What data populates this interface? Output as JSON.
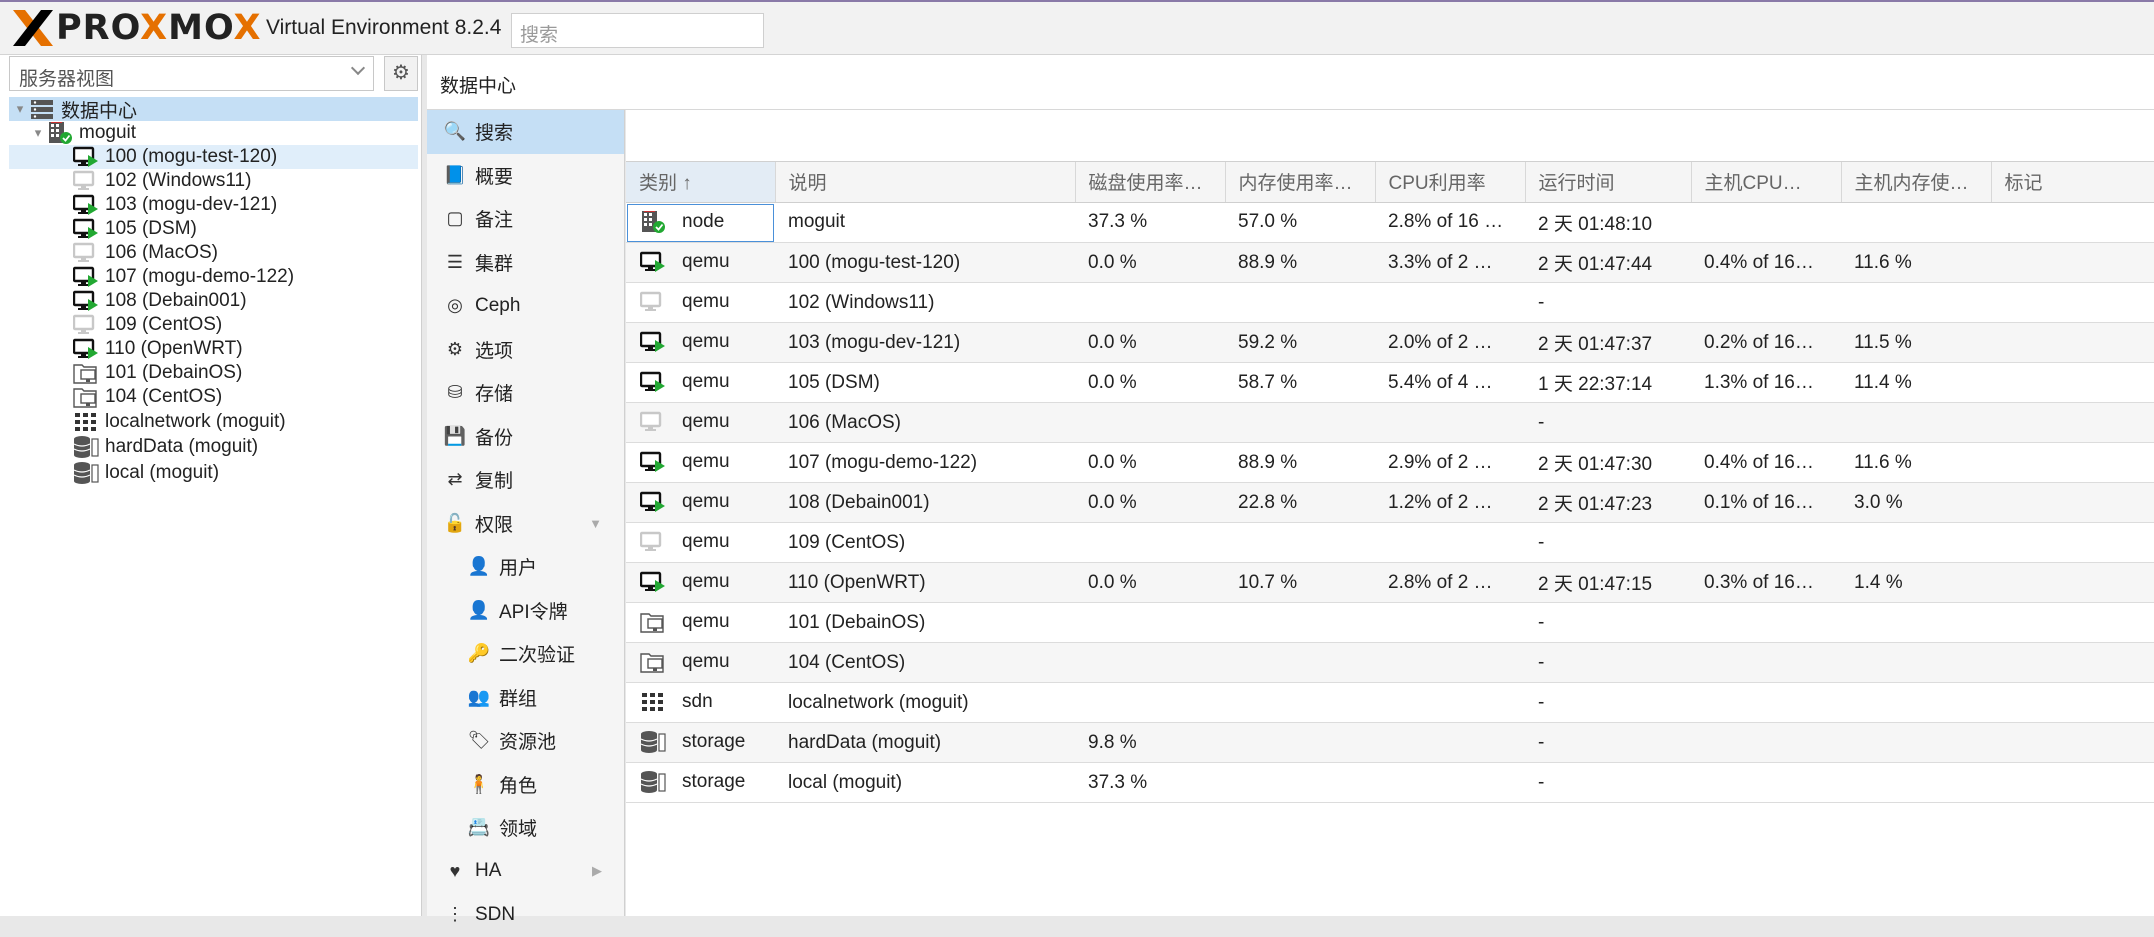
{
  "app": {
    "logo": "PROXMOX",
    "logo_x": "X",
    "logo_p": "PRO",
    "logo_o": "X",
    "logo_m": "MO",
    "logo_end": "X",
    "version": "Virtual Environment 8.2.4",
    "search_placeholder": "搜索"
  },
  "colors": {
    "accent": "#e57000",
    "selection": "#c5dff5",
    "running": "#22a832"
  },
  "left": {
    "view_select": "服务器视图",
    "tree": [
      {
        "label": "数据中心",
        "icon": "datacenter-icon",
        "level": 0,
        "toggle": "▾",
        "state": "selected"
      },
      {
        "label": "moguit",
        "icon": "node-icon",
        "level": 1,
        "toggle": "▾",
        "state": ""
      },
      {
        "label": "100 (mogu-test-120)",
        "icon": "vm-running-icon",
        "level": 2,
        "state": "hover"
      },
      {
        "label": "102 (Windows11)",
        "icon": "vm-stopped-icon",
        "level": 2,
        "state": ""
      },
      {
        "label": "103 (mogu-dev-121)",
        "icon": "vm-running-icon",
        "level": 2,
        "state": ""
      },
      {
        "label": "105 (DSM)",
        "icon": "vm-running-icon",
        "level": 2,
        "state": ""
      },
      {
        "label": "106 (MacOS)",
        "icon": "vm-stopped-icon",
        "level": 2,
        "state": ""
      },
      {
        "label": "107 (mogu-demo-122)",
        "icon": "vm-running-icon",
        "level": 2,
        "state": ""
      },
      {
        "label": "108 (Debain001)",
        "icon": "vm-running-icon",
        "level": 2,
        "state": ""
      },
      {
        "label": "109 (CentOS)",
        "icon": "vm-stopped-icon",
        "level": 2,
        "state": ""
      },
      {
        "label": "110 (OpenWRT)",
        "icon": "vm-running-icon",
        "level": 2,
        "state": ""
      },
      {
        "label": "101 (DebainOS)",
        "icon": "template-icon",
        "level": 2,
        "state": ""
      },
      {
        "label": "104 (CentOS)",
        "icon": "template-icon",
        "level": 2,
        "state": ""
      },
      {
        "label": "localnetwork (moguit)",
        "icon": "sdn-icon",
        "level": 2,
        "state": ""
      },
      {
        "label": "hardData (moguit)",
        "icon": "storage-icon",
        "level": 2,
        "state": ""
      },
      {
        "label": "local (moguit)",
        "icon": "storage-icon",
        "level": 2,
        "state": ""
      }
    ]
  },
  "breadcrumb": "数据中心",
  "menu": [
    {
      "label": "搜索",
      "icon": "search-icon",
      "glyph": "🔍",
      "sub": false,
      "selected": true
    },
    {
      "label": "概要",
      "icon": "book-icon",
      "glyph": "📘",
      "sub": false
    },
    {
      "label": "备注",
      "icon": "note-icon",
      "glyph": "▢",
      "sub": false
    },
    {
      "label": "集群",
      "icon": "server-icon",
      "glyph": "☰",
      "sub": false
    },
    {
      "label": "Ceph",
      "icon": "ceph-icon",
      "glyph": "◎",
      "sub": false
    },
    {
      "label": "选项",
      "icon": "gear-icon",
      "glyph": "⚙",
      "sub": false
    },
    {
      "label": "存储",
      "icon": "database-icon",
      "glyph": "⛁",
      "sub": false
    },
    {
      "label": "备份",
      "icon": "floppy-icon",
      "glyph": "💾",
      "sub": false
    },
    {
      "label": "复制",
      "icon": "retweet-icon",
      "glyph": "⇄",
      "sub": false
    },
    {
      "label": "权限",
      "icon": "unlock-icon",
      "glyph": "🔓",
      "sub": false,
      "arrow": "▼"
    },
    {
      "label": "用户",
      "icon": "user-icon",
      "glyph": "👤",
      "sub": true
    },
    {
      "label": "API令牌",
      "icon": "user-outline-icon",
      "glyph": "👤",
      "sub": true
    },
    {
      "label": "二次验证",
      "icon": "key-icon",
      "glyph": "🔑",
      "sub": true
    },
    {
      "label": "群组",
      "icon": "users-icon",
      "glyph": "👥",
      "sub": true
    },
    {
      "label": "资源池",
      "icon": "tags-icon",
      "glyph": "🏷",
      "sub": true
    },
    {
      "label": "角色",
      "icon": "male-icon",
      "glyph": "🧍",
      "sub": true
    },
    {
      "label": "领域",
      "icon": "address-book-icon",
      "glyph": "📇",
      "sub": true
    },
    {
      "label": "HA",
      "icon": "heartbeat-icon",
      "glyph": "♥",
      "sub": false,
      "arrow": "▶"
    },
    {
      "label": "SDN",
      "icon": "sdn-icon",
      "glyph": "⋮",
      "sub": false
    }
  ],
  "grid": {
    "columns": [
      "类别 ↑",
      "说明",
      "磁盘使用率…",
      "内存使用率…",
      "CPU利用率",
      "运行时间",
      "主机CPU…",
      "主机内存使…",
      "标记"
    ],
    "rows": [
      {
        "icon": "node-icon",
        "type": "node",
        "desc": "moguit",
        "disk": "37.3 %",
        "mem": "57.0 %",
        "cpu": "2.8% of 16 …",
        "uptime": "2 天 01:48:10",
        "hcpu": "",
        "hmem": "",
        "tags": ""
      },
      {
        "icon": "vm-running-icon",
        "type": "qemu",
        "desc": "100 (mogu-test-120)",
        "disk": "0.0 %",
        "mem": "88.9 %",
        "cpu": "3.3% of 2 …",
        "uptime": "2 天 01:47:44",
        "hcpu": "0.4% of 16…",
        "hmem": "11.6 %",
        "tags": ""
      },
      {
        "icon": "vm-stopped-icon",
        "type": "qemu",
        "desc": "102 (Windows11)",
        "disk": "",
        "mem": "",
        "cpu": "",
        "uptime": "-",
        "hcpu": "",
        "hmem": "",
        "tags": ""
      },
      {
        "icon": "vm-running-icon",
        "type": "qemu",
        "desc": "103 (mogu-dev-121)",
        "disk": "0.0 %",
        "mem": "59.2 %",
        "cpu": "2.0% of 2 …",
        "uptime": "2 天 01:47:37",
        "hcpu": "0.2% of 16…",
        "hmem": "11.5 %",
        "tags": ""
      },
      {
        "icon": "vm-running-icon",
        "type": "qemu",
        "desc": "105 (DSM)",
        "disk": "0.0 %",
        "mem": "58.7 %",
        "cpu": "5.4% of 4 …",
        "uptime": "1 天 22:37:14",
        "hcpu": "1.3% of 16…",
        "hmem": "11.4 %",
        "tags": ""
      },
      {
        "icon": "vm-stopped-icon",
        "type": "qemu",
        "desc": "106 (MacOS)",
        "disk": "",
        "mem": "",
        "cpu": "",
        "uptime": "-",
        "hcpu": "",
        "hmem": "",
        "tags": ""
      },
      {
        "icon": "vm-running-icon",
        "type": "qemu",
        "desc": "107 (mogu-demo-122)",
        "disk": "0.0 %",
        "mem": "88.9 %",
        "cpu": "2.9% of 2 …",
        "uptime": "2 天 01:47:30",
        "hcpu": "0.4% of 16…",
        "hmem": "11.6 %",
        "tags": ""
      },
      {
        "icon": "vm-running-icon",
        "type": "qemu",
        "desc": "108 (Debain001)",
        "disk": "0.0 %",
        "mem": "22.8 %",
        "cpu": "1.2% of 2 …",
        "uptime": "2 天 01:47:23",
        "hcpu": "0.1% of 16…",
        "hmem": "3.0 %",
        "tags": ""
      },
      {
        "icon": "vm-stopped-icon",
        "type": "qemu",
        "desc": "109 (CentOS)",
        "disk": "",
        "mem": "",
        "cpu": "",
        "uptime": "-",
        "hcpu": "",
        "hmem": "",
        "tags": ""
      },
      {
        "icon": "vm-running-icon",
        "type": "qemu",
        "desc": "110 (OpenWRT)",
        "disk": "0.0 %",
        "mem": "10.7 %",
        "cpu": "2.8% of 2 …",
        "uptime": "2 天 01:47:15",
        "hcpu": "0.3% of 16…",
        "hmem": "1.4 %",
        "tags": ""
      },
      {
        "icon": "template-icon",
        "type": "qemu",
        "desc": "101 (DebainOS)",
        "disk": "",
        "mem": "",
        "cpu": "",
        "uptime": "-",
        "hcpu": "",
        "hmem": "",
        "tags": ""
      },
      {
        "icon": "template-icon",
        "type": "qemu",
        "desc": "104 (CentOS)",
        "disk": "",
        "mem": "",
        "cpu": "",
        "uptime": "-",
        "hcpu": "",
        "hmem": "",
        "tags": ""
      },
      {
        "icon": "sdn-icon",
        "type": "sdn",
        "desc": "localnetwork (moguit)",
        "disk": "",
        "mem": "",
        "cpu": "",
        "uptime": "-",
        "hcpu": "",
        "hmem": "",
        "tags": ""
      },
      {
        "icon": "storage-icon",
        "type": "storage",
        "desc": "hardData (moguit)",
        "disk": "9.8 %",
        "mem": "",
        "cpu": "",
        "uptime": "-",
        "hcpu": "",
        "hmem": "",
        "tags": ""
      },
      {
        "icon": "storage-icon",
        "type": "storage",
        "desc": "local (moguit)",
        "disk": "37.3 %",
        "mem": "",
        "cpu": "",
        "uptime": "-",
        "hcpu": "",
        "hmem": "",
        "tags": ""
      }
    ]
  }
}
